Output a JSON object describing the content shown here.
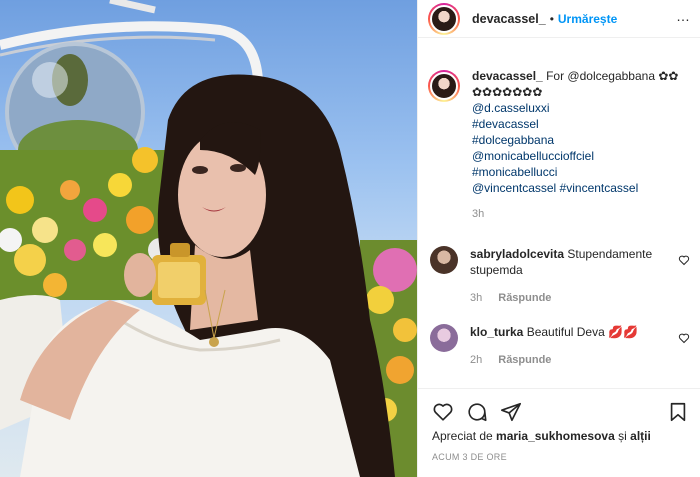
{
  "post": {
    "author": "devacassel_",
    "separator": "•",
    "follow_label": "Urmărește",
    "more_label": "…"
  },
  "caption": {
    "username": "devacassel_",
    "text_line1": "For @dolcegabbana ✿✿",
    "text_line2": "✿✿✿✿✿✿✿",
    "tags": [
      "@d.casseluxxi",
      "#devacassel",
      "#dolcegabbana",
      "@monicabelluccioffciel",
      "#monicabellucci",
      "@vincentcassel #vincentcassel"
    ],
    "time": "3h"
  },
  "comments": [
    {
      "username": "sabryladolcevita",
      "text": "Stupendamente stupemda",
      "time": "3h",
      "reply_label": "Răspunde"
    },
    {
      "username": "klo_turka",
      "text": "Beautiful Deva 💋💋",
      "time": "2h",
      "reply_label": "Răspunde"
    }
  ],
  "likes": {
    "prefix": "Apreciat de",
    "user": "maria_sukhomesova",
    "conjunction": "și",
    "others": "alții"
  },
  "timestamp": "ACUM 3 DE ORE",
  "icons": {
    "like": "heart-icon",
    "comment": "comment-icon",
    "share": "share-icon",
    "save": "bookmark-icon"
  },
  "colors": {
    "accent": "#0095f6",
    "tag": "#00376b",
    "muted": "#8e8e8e",
    "text": "#262626"
  }
}
